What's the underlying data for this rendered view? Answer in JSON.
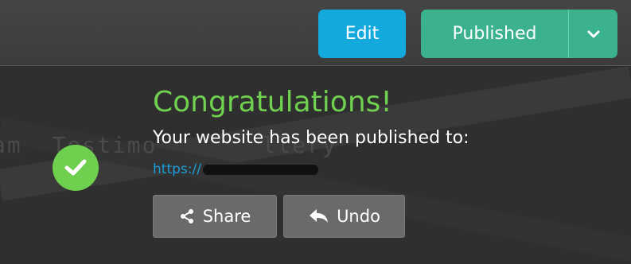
{
  "toolbar": {
    "edit_label": "Edit",
    "published_label": "Published"
  },
  "background": {
    "nav_text": "am  Testimo       llery"
  },
  "notice": {
    "title": "Congratulations!",
    "message": "Your website has been published to:",
    "url_prefix": "https://"
  },
  "actions": {
    "share_label": "Share",
    "undo_label": "Undo"
  },
  "colors": {
    "edit": "#14a9dc",
    "published": "#3bb28d",
    "success": "#70d04f",
    "link": "#1a9dd9"
  },
  "icons": [
    "chevron-down-icon",
    "checkmark-icon",
    "share-icon",
    "undo-icon"
  ]
}
